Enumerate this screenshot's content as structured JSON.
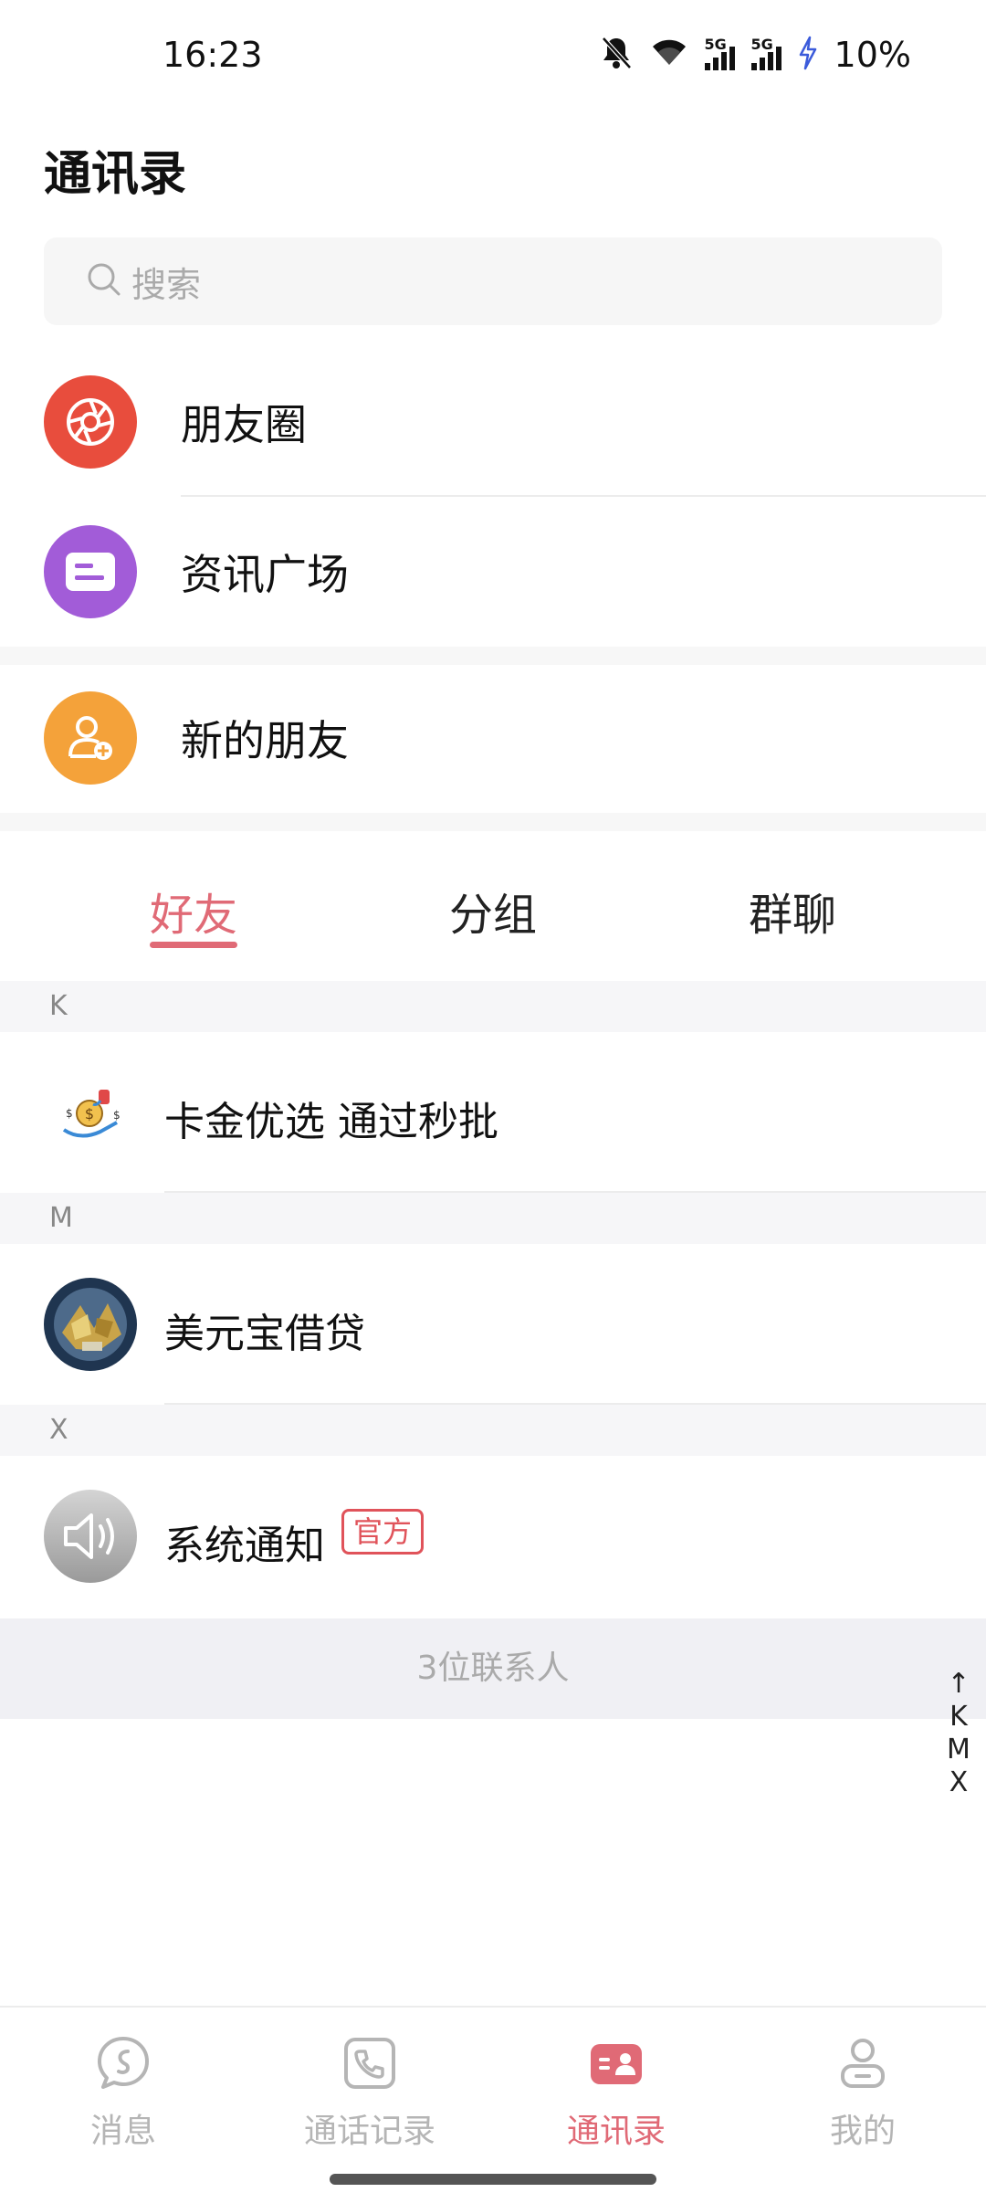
{
  "status_bar": {
    "time": "16:23",
    "battery": "10%",
    "signal_label": "5G"
  },
  "page_title": "通讯录",
  "search": {
    "placeholder": "搜索"
  },
  "entries": [
    {
      "label": "朋友圈",
      "color": "#e84d3d",
      "icon": "moments-icon"
    },
    {
      "label": "资讯广场",
      "color": "#a25cd8",
      "icon": "news-icon"
    },
    {
      "label": "新的朋友",
      "color": "#f4a23a",
      "icon": "add-friend-icon"
    }
  ],
  "tabs": [
    {
      "label": "好友",
      "active": true
    },
    {
      "label": "分组",
      "active": false
    },
    {
      "label": "群聊",
      "active": false
    }
  ],
  "contact_groups": [
    {
      "letter": "K",
      "contacts": [
        {
          "name": "卡金优选 通过秒批"
        }
      ]
    },
    {
      "letter": "M",
      "contacts": [
        {
          "name": "美元宝借贷"
        }
      ]
    },
    {
      "letter": "X",
      "contacts": [
        {
          "name": "系统通知",
          "badge": "官方"
        }
      ]
    }
  ],
  "contact_count": "3位联系人",
  "index_bar": {
    "arrow": "↑",
    "letters": [
      "K",
      "M",
      "X"
    ]
  },
  "bottom_nav": [
    {
      "label": "消息",
      "icon": "message-icon",
      "active": false
    },
    {
      "label": "通话记录",
      "icon": "call-log-icon",
      "active": false
    },
    {
      "label": "通讯录",
      "icon": "contacts-icon",
      "active": true
    },
    {
      "label": "我的",
      "icon": "profile-icon",
      "active": false
    }
  ],
  "colors": {
    "accent": "#e06a76",
    "badge": "#e0535a"
  }
}
